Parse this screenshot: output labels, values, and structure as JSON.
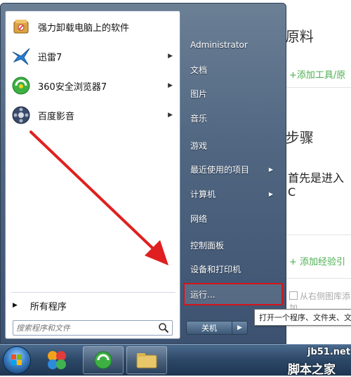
{
  "background_page": {
    "title": "工具/原料",
    "add_tool_link": "+添加工具/原",
    "steps_title": "方法/步骤",
    "step1_text": "首先是进入C",
    "add_step_link": "+ 添加经验引",
    "checkbox_label": "从右侧图库添加"
  },
  "start_menu": {
    "pinned": [
      {
        "label": "强力卸载电脑上的软件",
        "icon": "uninstall-icon"
      },
      {
        "label": "迅雷7",
        "icon": "thunder-icon"
      },
      {
        "label": "360安全浏览器7",
        "icon": "browser-360-icon"
      },
      {
        "label": "百度影音",
        "icon": "baidu-player-icon"
      }
    ],
    "all_programs": "所有程序",
    "search_placeholder": "搜索程序和文件",
    "right_items": {
      "user": "Administrator",
      "documents": "文档",
      "pictures": "图片",
      "music": "音乐",
      "games": "游戏",
      "recent": "最近使用的项目",
      "computer": "计算机",
      "network": "网络",
      "control_panel": "控制面板",
      "devices": "设备和打印机",
      "run": "运行..."
    },
    "shutdown": "关机",
    "tooltip": "打开一个程序、文件夹、文"
  },
  "watermark": {
    "site": "jb51.net",
    "name": "脚本之家"
  },
  "colors": {
    "highlight_red": "#d4141b",
    "annotation_arrow": "#e02020"
  }
}
